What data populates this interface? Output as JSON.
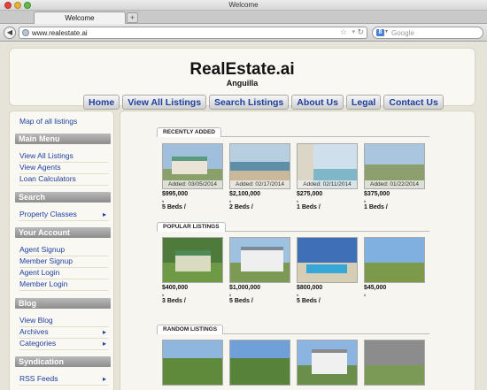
{
  "browser": {
    "window_title": "Welcome",
    "tab_label": "Welcome",
    "new_tab_label": "+",
    "url": "www.realestate.ai",
    "search_placeholder": "Google",
    "search_engine_letter": "8"
  },
  "site": {
    "title": "RealEstate.ai",
    "subtitle": "Anguilla"
  },
  "menu": [
    "Home",
    "View All Listings",
    "Search Listings",
    "About Us",
    "Legal",
    "Contact Us"
  ],
  "sidebar": {
    "map_link": "Map of all listings",
    "sections": [
      {
        "title": "Main Menu",
        "links": [
          {
            "label": "View All Listings",
            "arrow": false
          },
          {
            "label": "View Agents",
            "arrow": false
          },
          {
            "label": "Loan Calculators",
            "arrow": false
          }
        ]
      },
      {
        "title": "Search",
        "links": [
          {
            "label": "Property Classes",
            "arrow": true
          }
        ]
      },
      {
        "title": "Your Account",
        "links": [
          {
            "label": "Agent Signup",
            "arrow": false
          },
          {
            "label": "Member Signup",
            "arrow": false
          },
          {
            "label": "Agent Login",
            "arrow": false
          },
          {
            "label": "Member Login",
            "arrow": false
          }
        ]
      },
      {
        "title": "Blog",
        "links": [
          {
            "label": "View Blog",
            "arrow": false
          },
          {
            "label": "Archives",
            "arrow": true
          },
          {
            "label": "Categories",
            "arrow": true
          }
        ]
      },
      {
        "title": "Syndication",
        "links": [
          {
            "label": "RSS Feeds",
            "arrow": true
          }
        ]
      }
    ]
  },
  "listings": {
    "recently_added": {
      "title": "RECENTLY ADDED",
      "items": [
        {
          "added": "Added: 03/05/2014",
          "price": "$995,000",
          "comma": ",",
          "beds": "5 Beds  /"
        },
        {
          "added": "Added: 02/17/2014",
          "price": "$2,100,000",
          "comma": ",",
          "beds": "2 Beds  /"
        },
        {
          "added": "Added: 02/11/2014",
          "price": "$275,000",
          "comma": ",",
          "beds": "1 Beds  /"
        },
        {
          "added": "Added: 01/22/2014",
          "price": "$375,000",
          "comma": ",",
          "beds": "1 Beds  /"
        }
      ]
    },
    "popular": {
      "title": "POPULAR LISTINGS",
      "items": [
        {
          "price": "$400,000",
          "comma": ",",
          "beds": "3 Beds  /"
        },
        {
          "price": "$1,000,000",
          "comma": ",",
          "beds": "5 Beds  /"
        },
        {
          "price": "$800,000",
          "comma": ",",
          "beds": "5 Beds  /"
        },
        {
          "price": "$45,000",
          "comma": ",",
          "beds": ""
        }
      ]
    },
    "random": {
      "title": "RANDOM LISTINGS"
    }
  }
}
